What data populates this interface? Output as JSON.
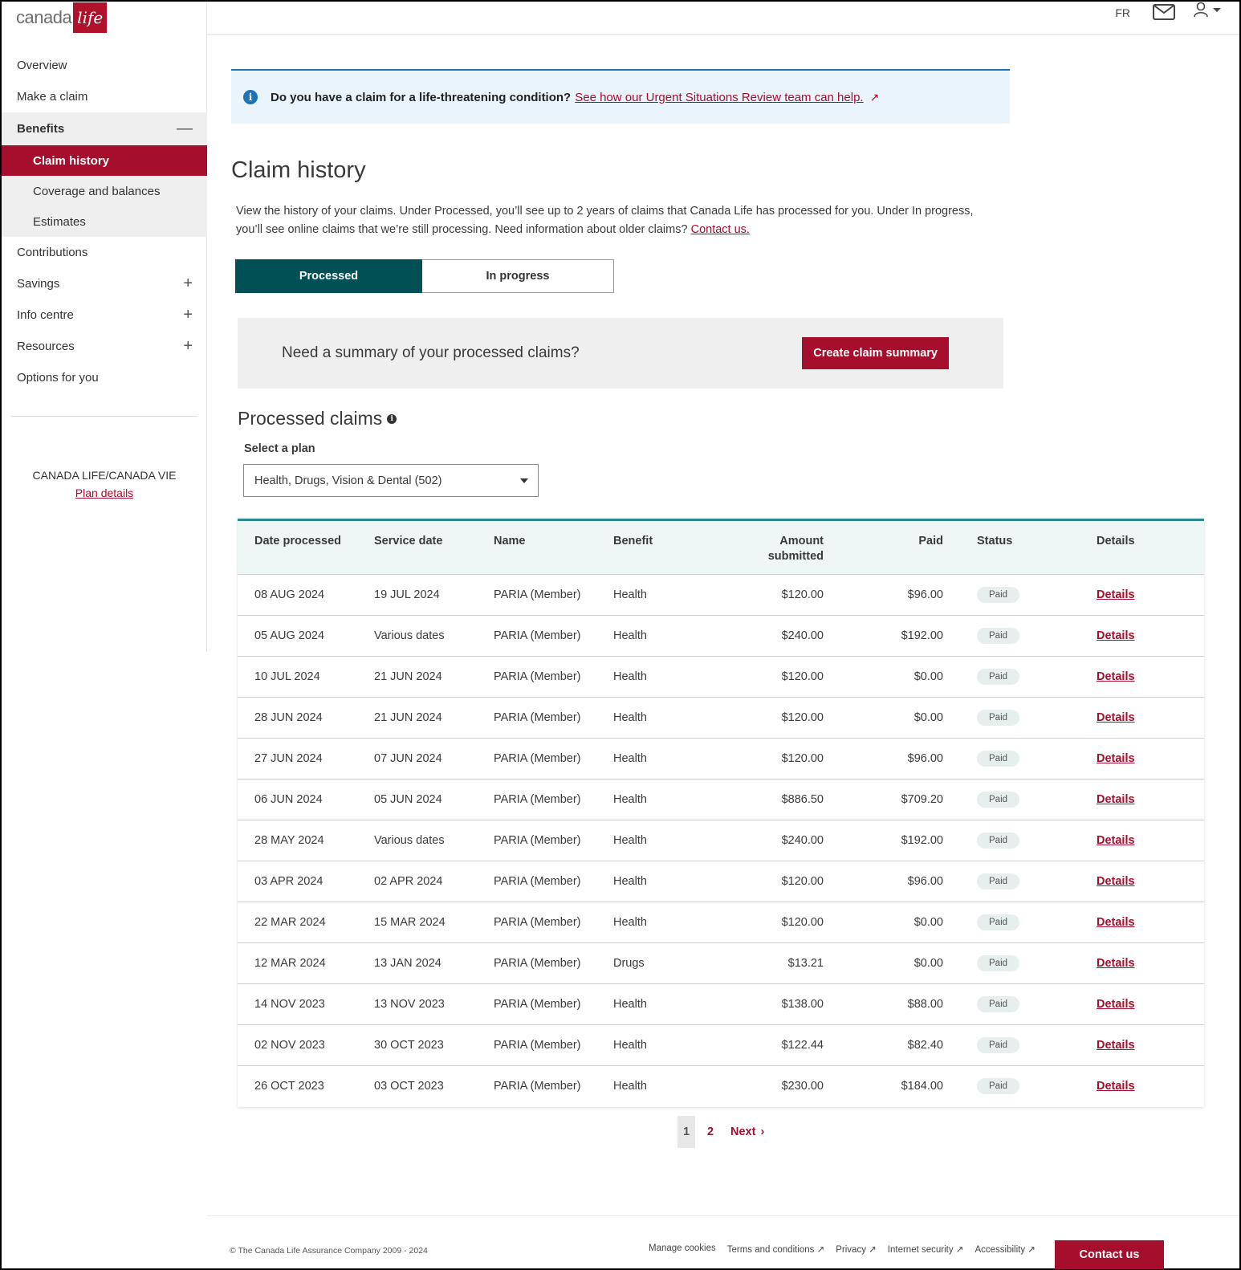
{
  "brand": {
    "logo_text": "canada",
    "logo_mark": "life",
    "accent": "#a50e2c",
    "teal": "#005055"
  },
  "header": {
    "lang_toggle": "FR",
    "mail_icon": "envelope-icon",
    "user_icon": "user-icon"
  },
  "sidebar": {
    "items": [
      {
        "label": "Overview"
      },
      {
        "label": "Make a claim"
      },
      {
        "label": "Benefits",
        "toggle": "—"
      },
      {
        "label": "Claim history"
      },
      {
        "label": "Coverage and balances"
      },
      {
        "label": "Estimates"
      },
      {
        "label": "Contributions"
      },
      {
        "label": "Savings",
        "toggle": "+"
      },
      {
        "label": "Info centre",
        "toggle": "+"
      },
      {
        "label": "Resources",
        "toggle": "+"
      },
      {
        "label": "Options for you"
      }
    ],
    "plan_name": "CANADA LIFE/CANADA VIE",
    "plan_link": "Plan details"
  },
  "banner": {
    "question": "Do you have a claim for a life-threatening condition?",
    "link": "See how our Urgent Situations Review team can help."
  },
  "main": {
    "title": "Claim history",
    "intro": "View the history of your claims. Under Processed, you’ll see up to 2 years of claims that Canada Life has processed for you. Under In progress, you’ll see online claims that we’re still processing. Need information about older claims?",
    "intro_link": "Contact us.",
    "tabs": [
      {
        "label": "Processed"
      },
      {
        "label": "In progress"
      }
    ],
    "summary": {
      "text": "Need a summary of your processed claims?",
      "button": "Create claim summary"
    },
    "section_title": "Processed claims",
    "select_label": "Select a plan",
    "select_value": "Health, Drugs, Vision & Dental (502)"
  },
  "table": {
    "headers": [
      "Date processed",
      "Service date",
      "Name",
      "Benefit",
      "Amount submitted",
      "Paid",
      "Status",
      "Details"
    ],
    "rows": [
      [
        "08 AUG 2024",
        "19 JUL 2024",
        "PARIA (Member)",
        "Health",
        "$120.00",
        "$96.00",
        "Paid",
        "Details"
      ],
      [
        "05 AUG 2024",
        "Various dates",
        "PARIA (Member)",
        "Health",
        "$240.00",
        "$192.00",
        "Paid",
        "Details"
      ],
      [
        "10 JUL 2024",
        "21 JUN 2024",
        "PARIA (Member)",
        "Health",
        "$120.00",
        "$0.00",
        "Paid",
        "Details"
      ],
      [
        "28 JUN 2024",
        "21 JUN 2024",
        "PARIA (Member)",
        "Health",
        "$120.00",
        "$0.00",
        "Paid",
        "Details"
      ],
      [
        "27 JUN 2024",
        "07 JUN 2024",
        "PARIA (Member)",
        "Health",
        "$120.00",
        "$96.00",
        "Paid",
        "Details"
      ],
      [
        "06 JUN 2024",
        "05 JUN 2024",
        "PARIA (Member)",
        "Health",
        "$886.50",
        "$709.20",
        "Paid",
        "Details"
      ],
      [
        "28 MAY 2024",
        "Various dates",
        "PARIA (Member)",
        "Health",
        "$240.00",
        "$192.00",
        "Paid",
        "Details"
      ],
      [
        "03 APR 2024",
        "02 APR 2024",
        "PARIA (Member)",
        "Health",
        "$120.00",
        "$96.00",
        "Paid",
        "Details"
      ],
      [
        "22 MAR 2024",
        "15 MAR 2024",
        "PARIA (Member)",
        "Health",
        "$120.00",
        "$0.00",
        "Paid",
        "Details"
      ],
      [
        "12 MAR 2024",
        "13 JAN 2024",
        "PARIA (Member)",
        "Drugs",
        "$13.21",
        "$0.00",
        "Paid",
        "Details"
      ],
      [
        "14 NOV 2023",
        "13 NOV 2023",
        "PARIA (Member)",
        "Health",
        "$138.00",
        "$88.00",
        "Paid",
        "Details"
      ],
      [
        "02 NOV 2023",
        "30 OCT 2023",
        "PARIA (Member)",
        "Health",
        "$122.44",
        "$82.40",
        "Paid",
        "Details"
      ],
      [
        "26 OCT 2023",
        "03 OCT 2023",
        "PARIA (Member)",
        "Health",
        "$230.00",
        "$184.00",
        "Paid",
        "Details"
      ]
    ]
  },
  "pagination": {
    "current": "1",
    "page2": "2",
    "next": "Next"
  },
  "footer": {
    "copyright": "© The Canada Life Assurance Company 2009 - 2024",
    "links": [
      "Manage cookies",
      "Terms and conditions ↗",
      "Privacy ↗",
      "Internet security ↗",
      "Accessibility ↗"
    ],
    "contact": "Contact us"
  }
}
